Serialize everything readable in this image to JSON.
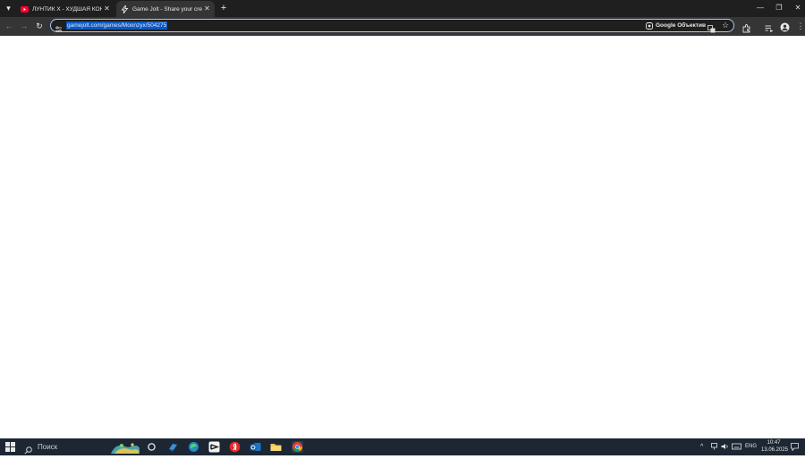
{
  "browser": {
    "tabs": [
      {
        "title": "ЛУНТИК X - ХУДШАЯ КОНЦОВКА",
        "favicon": "youtube-icon",
        "active": false
      },
      {
        "title": "Game Jolt - Share your creations",
        "favicon": "gamejolt-icon",
        "active": true
      }
    ],
    "address_bar": {
      "url": "gamejolt.com/games/Moonzyx/504275"
    },
    "lens_label": "Google Объектив"
  },
  "taskbar": {
    "search_placeholder": "Поиск",
    "language": "ENG",
    "time": "10:47",
    "date": "13.06.2025"
  },
  "colors": {
    "tab_strip": "#1f1f1f",
    "toolbar": "#353535",
    "url_highlight": "#0a59c8",
    "taskbar": "#1c2733",
    "page_background": "#ffffff"
  }
}
